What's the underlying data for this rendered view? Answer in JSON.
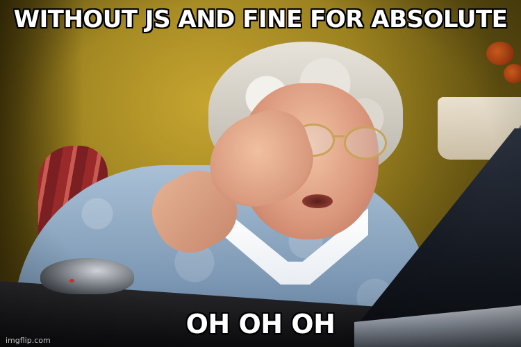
{
  "meme": {
    "top_text": "WITHOUT JS AND FINE FOR ABSOLUTE",
    "bottom_text": "OH OH OH",
    "watermark": "imgflip.com"
  },
  "colors": {
    "caption_fill": "#ffffff",
    "caption_outline": "#000000",
    "wall": "#c6a530",
    "sweater": "#8fa8c2"
  }
}
